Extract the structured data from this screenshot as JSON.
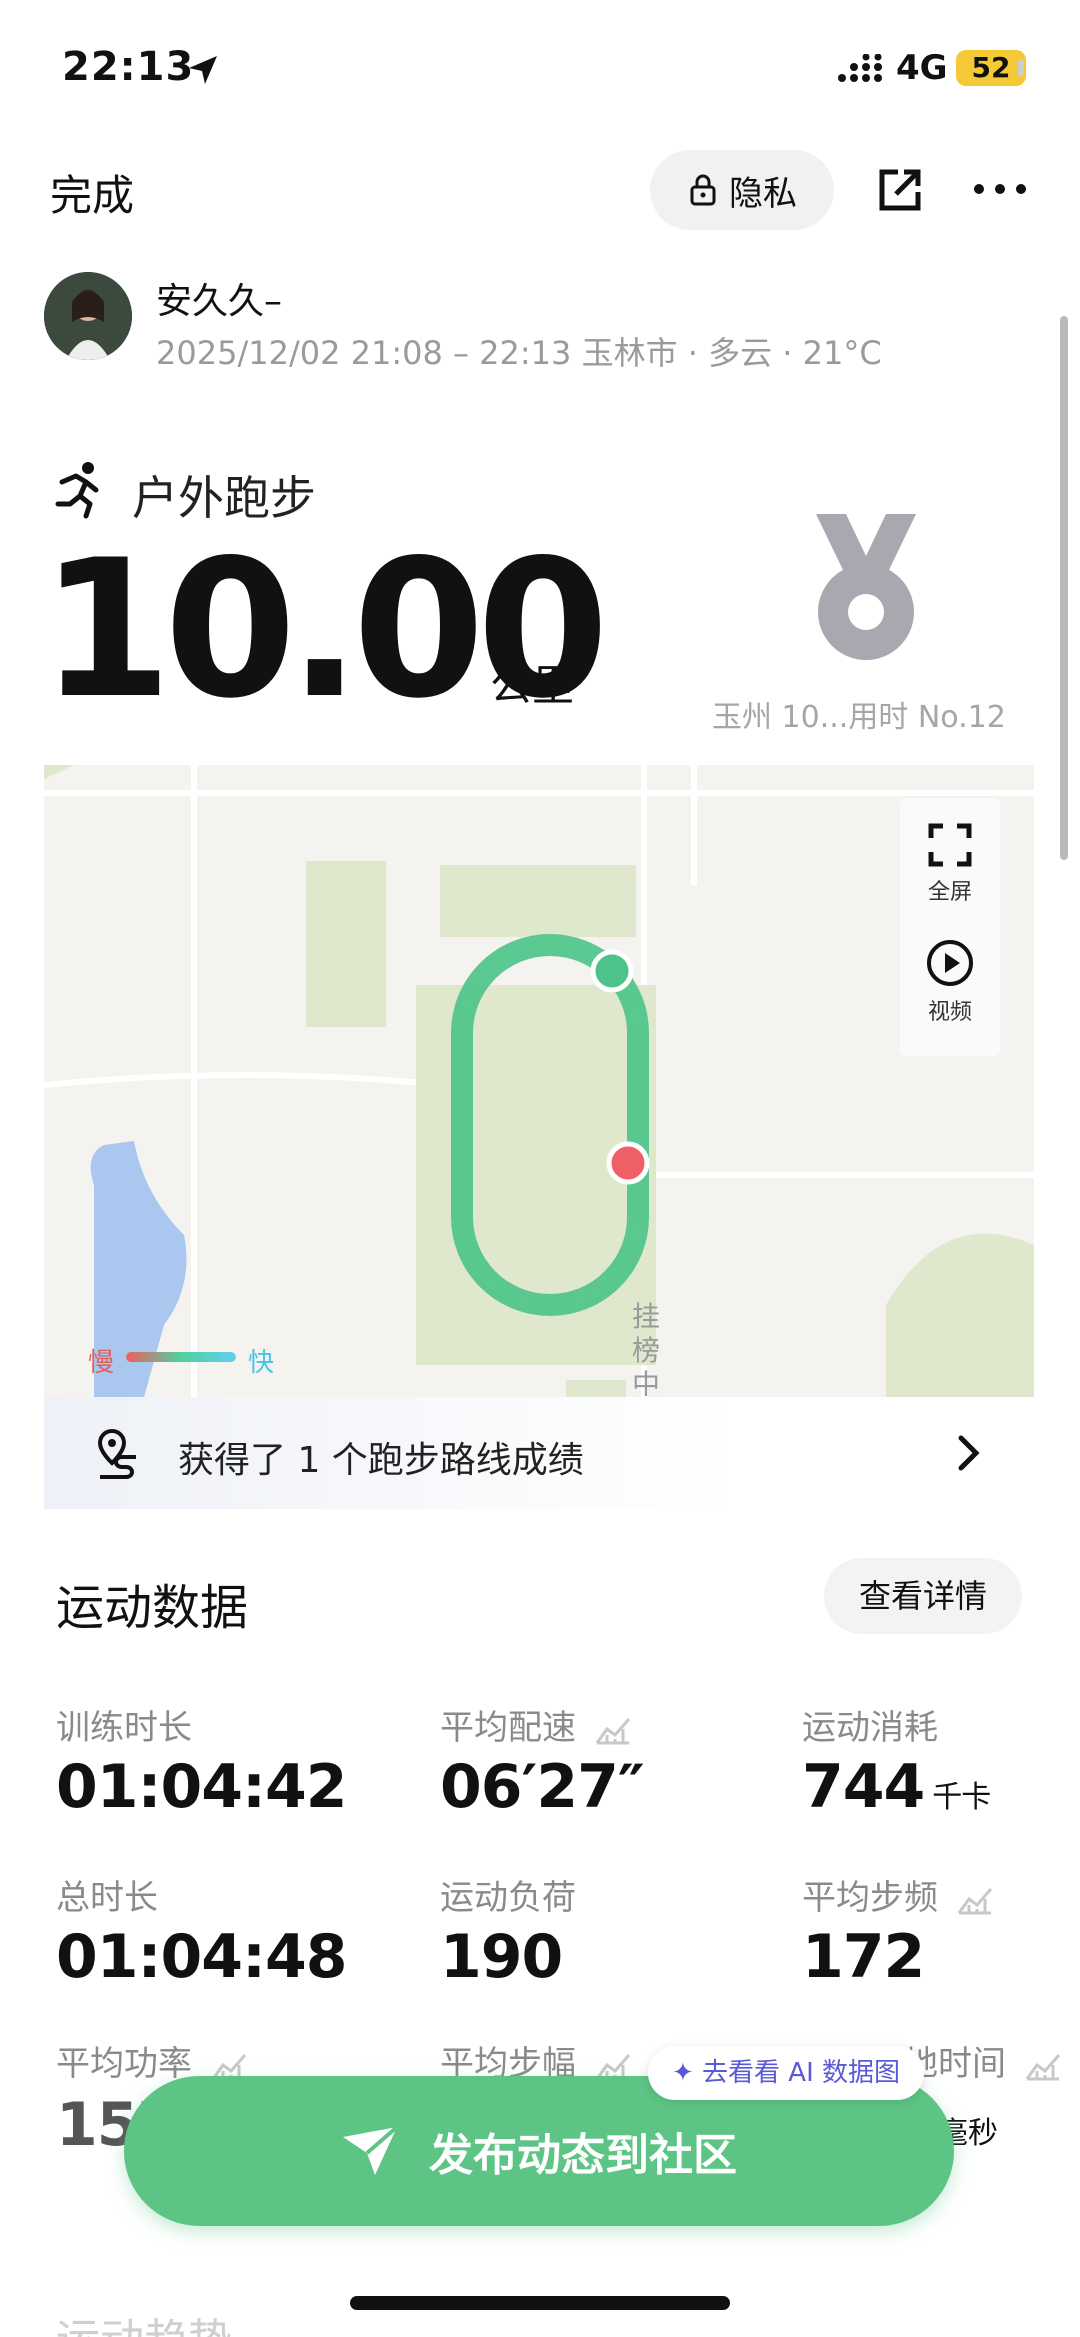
{
  "status_bar": {
    "time": "22:13",
    "network": "4G",
    "battery": "52"
  },
  "header": {
    "done_label": "完成",
    "privacy_label": "隐私"
  },
  "user": {
    "name": "安久久–",
    "meta": "2025/12/02 21:08 – 22:13 玉林市 · 多云 · 21°C"
  },
  "workout": {
    "type": "户外跑步",
    "distance": "10.00",
    "unit": "公里",
    "medal_caption": "玉州 10...用时 No.12"
  },
  "map": {
    "fullscreen_label": "全屏",
    "video_label": "视频",
    "legend_slow": "慢",
    "legend_fast": "快",
    "poi_label": "挂榜中"
  },
  "route_banner": {
    "text": "获得了 1 个跑步路线成绩"
  },
  "stats_section": {
    "title": "运动数据",
    "details_label": "查看详情",
    "items": [
      {
        "label": "训练时长",
        "value": "01:04:42"
      },
      {
        "label": "平均配速",
        "value": "06′27″"
      },
      {
        "label": "运动消耗",
        "value": "744",
        "unit": "千卡"
      },
      {
        "label": "总时长",
        "value": "01:04:48"
      },
      {
        "label": "运动负荷",
        "value": "190"
      },
      {
        "label": "平均步频",
        "value": "172"
      },
      {
        "label": "平均功率",
        "value": "157"
      },
      {
        "label": "平均步幅"
      },
      {
        "label": "平均触地时间",
        "unit": "毫秒"
      }
    ]
  },
  "ai_tag": "去看看 AI 数据图",
  "publish_button": "发布动态到社区",
  "next_section_title": "运动趋势",
  "colors": {
    "accent": "#5ec486",
    "route": "#4cc38a",
    "start_dot": "#4cc38a",
    "end_dot": "#ef5f66"
  }
}
